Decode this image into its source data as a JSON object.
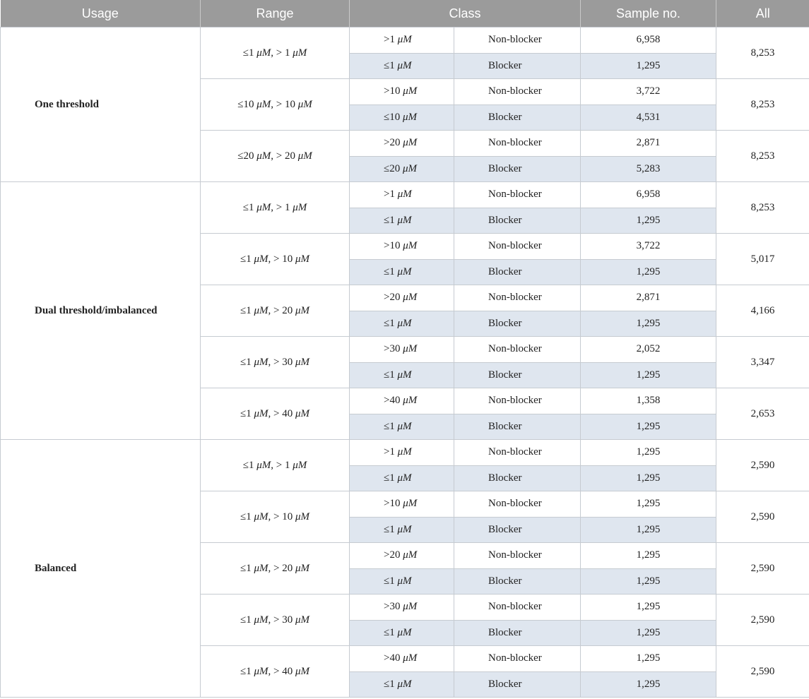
{
  "header": {
    "usage": "Usage",
    "range": "Range",
    "class": "Class",
    "sample_no": "Sample no.",
    "all": "All"
  },
  "groups": [
    {
      "usage": "One threshold",
      "blocks": [
        {
          "range": "≤1 μM, > 1 μM",
          "all": "8,253",
          "rows": [
            {
              "threshold": ">1 μM",
              "class": "Non-blocker",
              "n": "6,958"
            },
            {
              "threshold": "≤1 μM",
              "class": "Blocker",
              "n": "1,295"
            }
          ]
        },
        {
          "range": "≤10 μM, > 10 μM",
          "all": "8,253",
          "rows": [
            {
              "threshold": ">10 μM",
              "class": "Non-blocker",
              "n": "3,722"
            },
            {
              "threshold": "≤10 μM",
              "class": "Blocker",
              "n": "4,531"
            }
          ]
        },
        {
          "range": "≤20 μM, > 20 μM",
          "all": "8,253",
          "rows": [
            {
              "threshold": ">20 μM",
              "class": "Non-blocker",
              "n": "2,871"
            },
            {
              "threshold": "≤20 μM",
              "class": "Blocker",
              "n": "5,283"
            }
          ]
        }
      ]
    },
    {
      "usage": "Dual threshold/imbalanced",
      "blocks": [
        {
          "range": "≤1 μM, > 1 μM",
          "all": "8,253",
          "rows": [
            {
              "threshold": ">1 μM",
              "class": "Non-blocker",
              "n": "6,958"
            },
            {
              "threshold": "≤1 μM",
              "class": "Blocker",
              "n": "1,295"
            }
          ]
        },
        {
          "range": "≤1 μM, > 10 μM",
          "all": "5,017",
          "rows": [
            {
              "threshold": ">10 μM",
              "class": "Non-blocker",
              "n": "3,722"
            },
            {
              "threshold": "≤1 μM",
              "class": "Blocker",
              "n": "1,295"
            }
          ]
        },
        {
          "range": "≤1 μM, > 20 μM",
          "all": "4,166",
          "rows": [
            {
              "threshold": ">20 μM",
              "class": "Non-blocker",
              "n": "2,871"
            },
            {
              "threshold": "≤1 μM",
              "class": "Blocker",
              "n": "1,295"
            }
          ]
        },
        {
          "range": "≤1 μM, > 30 μM",
          "all": "3,347",
          "rows": [
            {
              "threshold": ">30 μM",
              "class": "Non-blocker",
              "n": "2,052"
            },
            {
              "threshold": "≤1 μM",
              "class": "Blocker",
              "n": "1,295"
            }
          ]
        },
        {
          "range": "≤1 μM, > 40 μM",
          "all": "2,653",
          "rows": [
            {
              "threshold": ">40 μM",
              "class": "Non-blocker",
              "n": "1,358"
            },
            {
              "threshold": "≤1 μM",
              "class": "Blocker",
              "n": "1,295"
            }
          ]
        }
      ]
    },
    {
      "usage": "Balanced",
      "blocks": [
        {
          "range": "≤1 μM, > 1 μM",
          "all": "2,590",
          "rows": [
            {
              "threshold": ">1 μM",
              "class": "Non-blocker",
              "n": "1,295"
            },
            {
              "threshold": "≤1 μM",
              "class": "Blocker",
              "n": "1,295"
            }
          ]
        },
        {
          "range": "≤1 μM, > 10 μM",
          "all": "2,590",
          "rows": [
            {
              "threshold": ">10 μM",
              "class": "Non-blocker",
              "n": "1,295"
            },
            {
              "threshold": "≤1 μM",
              "class": "Blocker",
              "n": "1,295"
            }
          ]
        },
        {
          "range": "≤1 μM, > 20 μM",
          "all": "2,590",
          "rows": [
            {
              "threshold": ">20 μM",
              "class": "Non-blocker",
              "n": "1,295"
            },
            {
              "threshold": "≤1 μM",
              "class": "Blocker",
              "n": "1,295"
            }
          ]
        },
        {
          "range": "≤1 μM, > 30 μM",
          "all": "2,590",
          "rows": [
            {
              "threshold": ">30 μM",
              "class": "Non-blocker",
              "n": "1,295"
            },
            {
              "threshold": "≤1 μM",
              "class": "Blocker",
              "n": "1,295"
            }
          ]
        },
        {
          "range": "≤1 μM, > 40 μM",
          "all": "2,590",
          "rows": [
            {
              "threshold": ">40 μM",
              "class": "Non-blocker",
              "n": "1,295"
            },
            {
              "threshold": "≤1 μM",
              "class": "Blocker",
              "n": "1,295"
            }
          ]
        }
      ]
    }
  ]
}
